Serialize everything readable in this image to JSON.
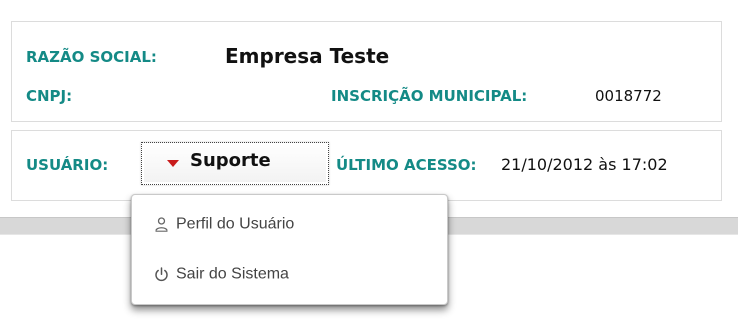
{
  "company": {
    "razao_social_label": "RAZÃO SOCIAL:",
    "razao_social_value": "Empresa Teste",
    "cnpj_label": "CNPJ:",
    "cnpj_value": "",
    "inscricao_municipal_label": "INSCRIÇÃO MUNICIPAL:",
    "inscricao_municipal_value": "0018772"
  },
  "user_info": {
    "usuario_label": "USUÁRIO:",
    "usuario_value": "Suporte",
    "ultimo_acesso_label": "ÚLTIMO ACESSO:",
    "ultimo_acesso_value": "21/10/2012 às 17:02"
  },
  "dropdown": {
    "items": [
      {
        "label": "Perfil do Usuário",
        "icon": "user-icon"
      },
      {
        "label": "Sair do Sistema",
        "icon": "power-icon"
      }
    ]
  },
  "colors": {
    "label_teal": "#148a86",
    "caret_red": "#c81b1b",
    "text_dark": "#111111",
    "menu_text": "#444444",
    "divider_gray": "#d8d8d8"
  }
}
